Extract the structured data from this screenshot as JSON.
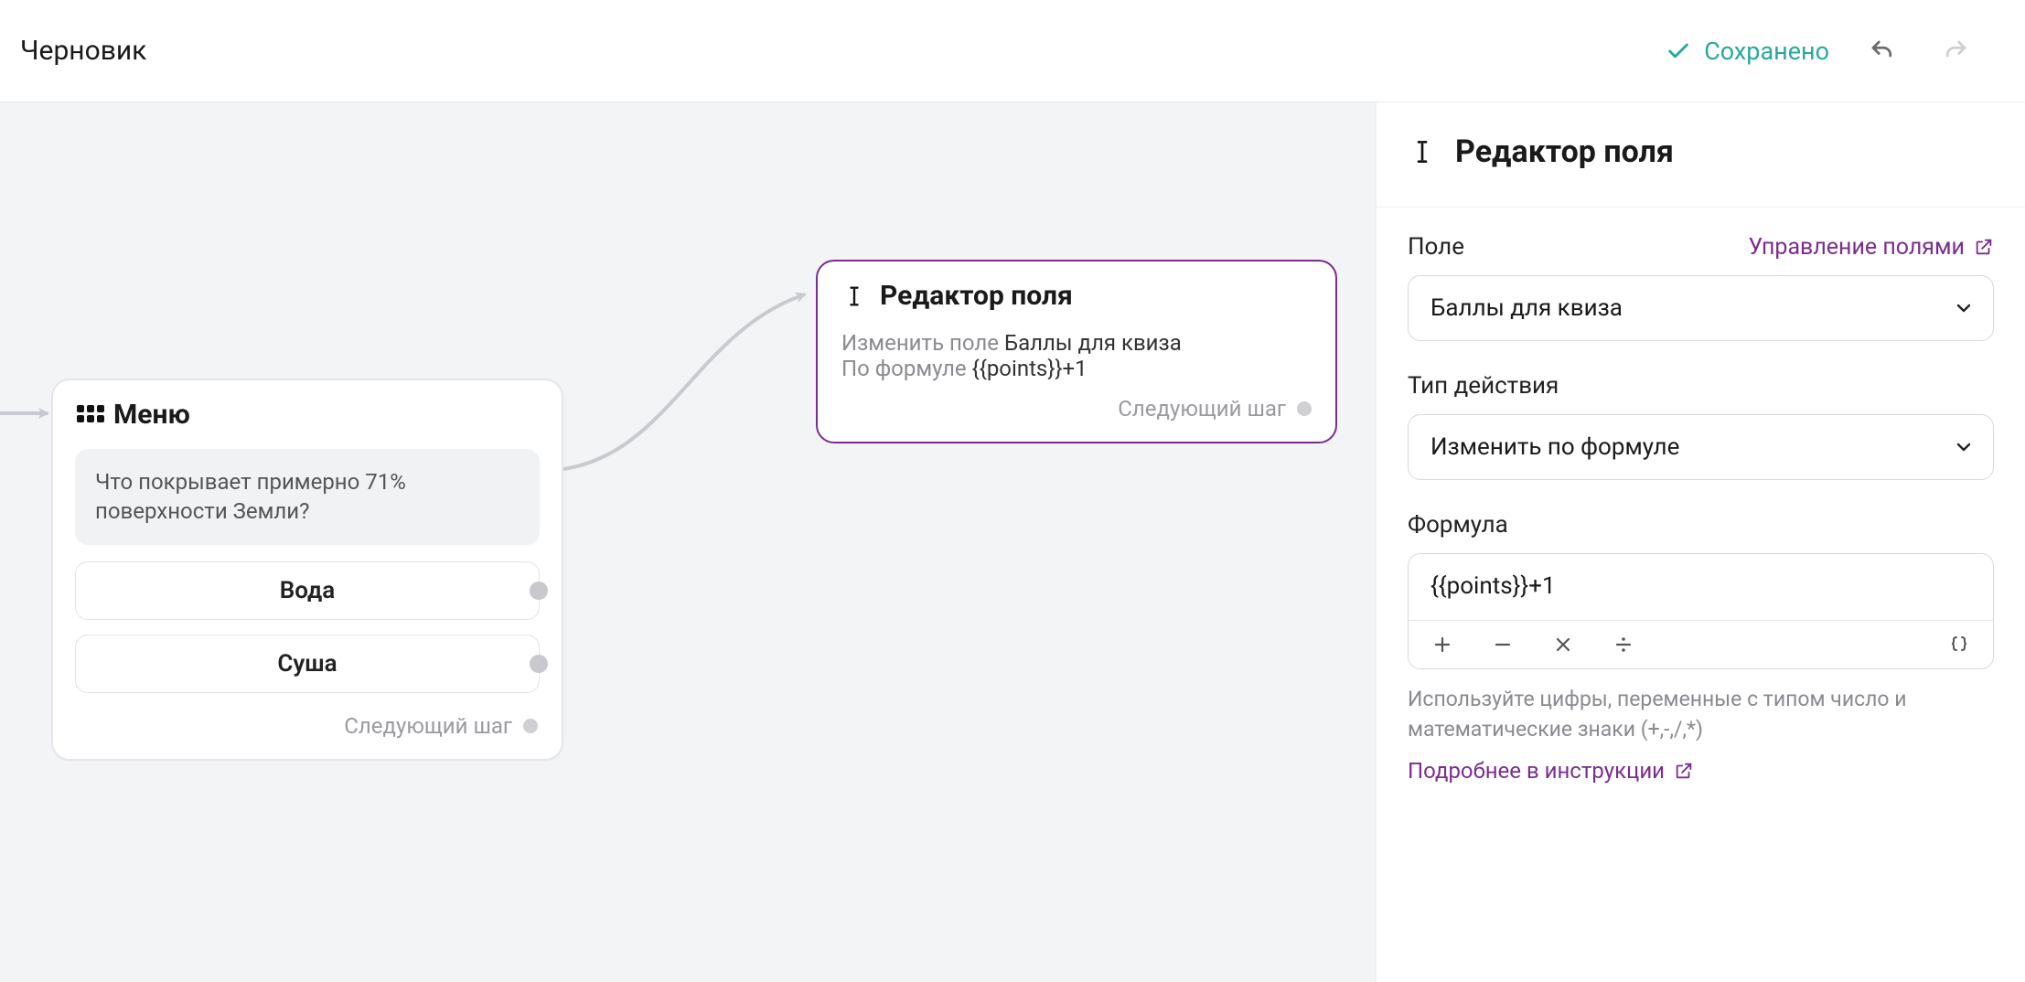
{
  "topbar": {
    "title": "Черновик",
    "saved_label": "Сохранено"
  },
  "canvas": {
    "menu_card": {
      "title": "Меню",
      "question": "Что покрывает примерно 71% поверхности Земли?",
      "option1": "Вода",
      "option2": "Суша",
      "next_label": "Следующий шаг"
    },
    "editor_card": {
      "title": "Редактор поля",
      "line1_prefix": "Изменить поле ",
      "line1_value": "Баллы для квиза",
      "line2_prefix": "По формуле ",
      "line2_value": "{{points}}+1",
      "next_label": "Следующий шаг"
    }
  },
  "sidebar": {
    "title": "Редактор поля",
    "field_label": "Поле",
    "manage_fields_label": "Управление полями",
    "field_value": "Баллы для квиза",
    "action_type_label": "Тип действия",
    "action_type_value": "Изменить по формуле",
    "formula_label": "Формула",
    "formula_value": "{{points}}+1",
    "help_text": "Используйте цифры, переменные с типом число и математические знаки (+,-,/,*)",
    "doc_link_label": "Подробнее в инструкции"
  }
}
